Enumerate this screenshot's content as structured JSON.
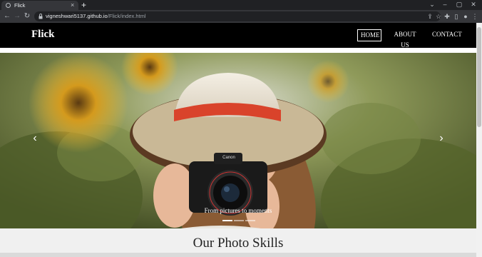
{
  "browser": {
    "tab_title": "Flick",
    "url_domain": "vigneshwari5137.github.io",
    "url_path": "/Flick/index.html",
    "new_tab_glyph": "+",
    "close_glyph": "×"
  },
  "navbar": {
    "brand": "Flick",
    "links": [
      {
        "label": "HOME",
        "active": true
      },
      {
        "label": "ABOUT US",
        "active": false
      },
      {
        "label": "CONTACT",
        "active": false
      }
    ]
  },
  "carousel": {
    "caption": "From pictures to moments",
    "slides_count": 3,
    "active_index": 0,
    "prev_glyph": "‹",
    "next_glyph": "›"
  },
  "section": {
    "title": "Our Photo Skills"
  },
  "icons": {
    "back": "arrow-left-icon",
    "forward": "arrow-right-icon",
    "reload": "reload-icon",
    "lock": "lock-icon"
  }
}
